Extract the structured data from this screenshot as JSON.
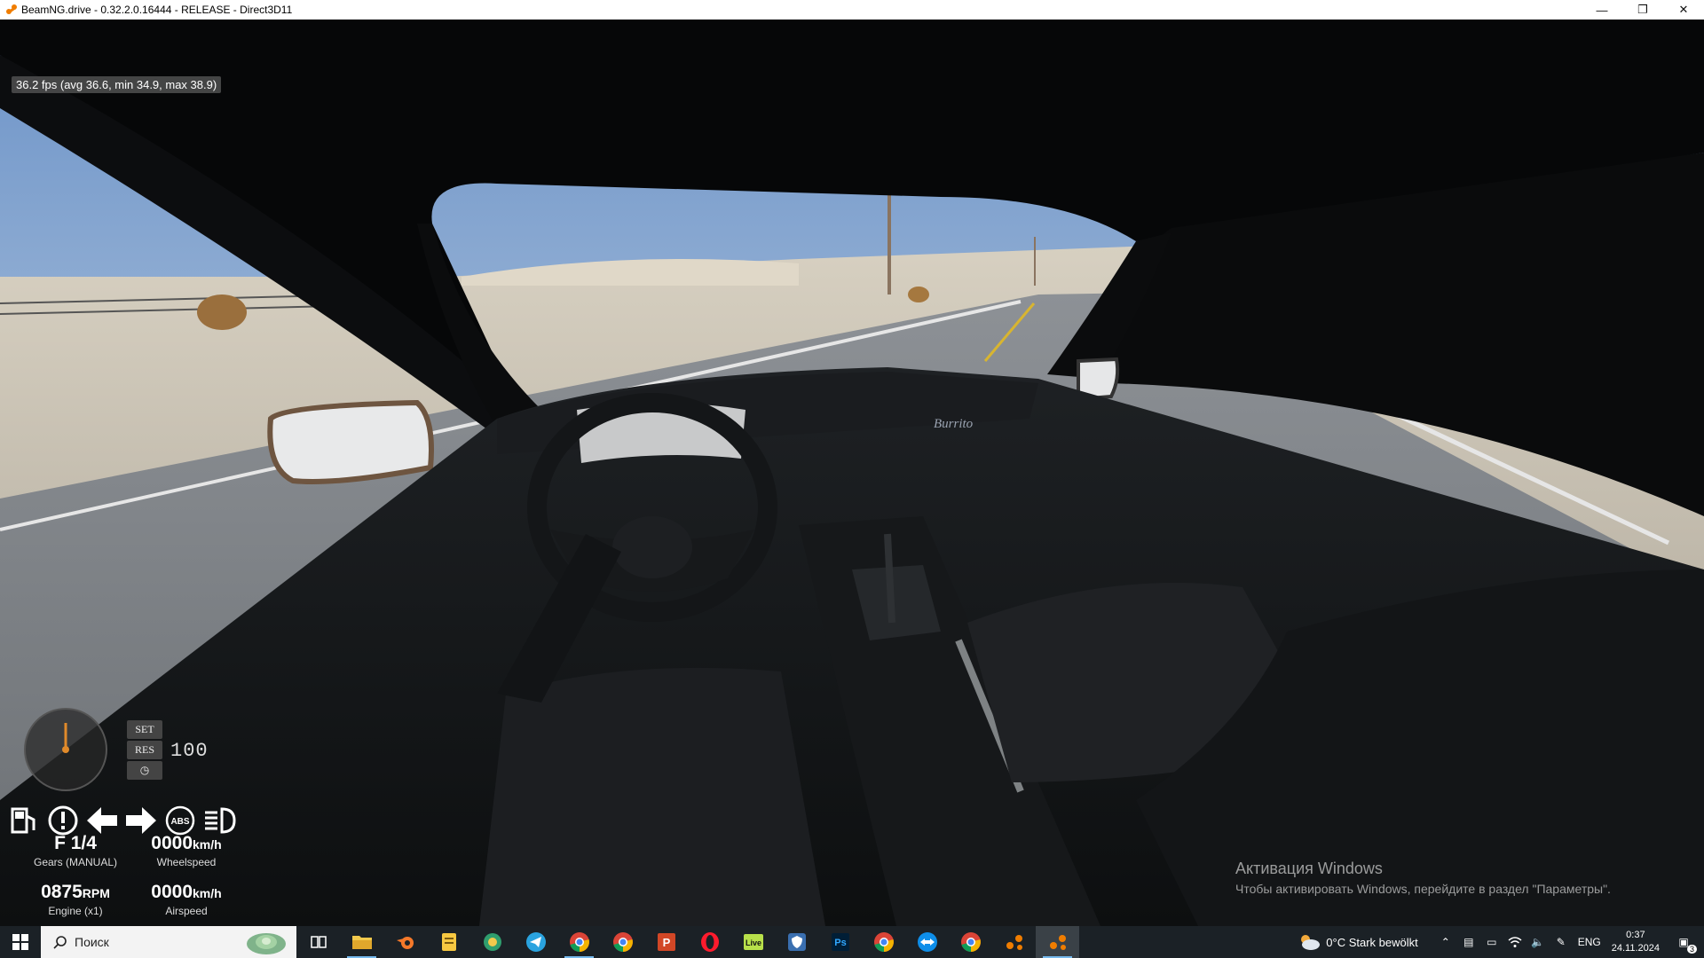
{
  "window": {
    "title": "BeamNG.drive - 0.32.2.0.16444 - RELEASE - Direct3D11",
    "minimize_icon": "minimize-icon",
    "restore_icon": "restore-icon",
    "close_icon": "close-icon"
  },
  "hud": {
    "fps": "36.2 fps (avg  36.6, min  34.9, max  38.9)",
    "cruise": {
      "set_label": "SET",
      "res_label": "RES",
      "speed_display": "100"
    },
    "indicators": [
      "fuel-icon",
      "warning-icon",
      "left-turn-arrow-icon",
      "right-turn-arrow-icon",
      "abs-icon",
      "headlight-icon"
    ],
    "gear": {
      "value": "F 1/4",
      "label": "Gears (MANUAL)"
    },
    "wheelspeed": {
      "value": "0000",
      "unit": "km/h",
      "label": "Wheelspeed"
    },
    "engine": {
      "value": "0875",
      "unit": "RPM",
      "label": "Engine (x1)"
    },
    "airspeed": {
      "value": "0000",
      "unit": "km/h",
      "label": "Airspeed"
    }
  },
  "activation": {
    "title": "Активация Windows",
    "subtitle": "Чтобы активировать Windows, перейдите в раздел \"Параметры\"."
  },
  "taskbar": {
    "search_placeholder": "Поиск",
    "apps": [
      "task-view-icon",
      "file-explorer-icon",
      "blender-icon",
      "notes-icon",
      "globe-icon",
      "telegram-icon",
      "chrome-icon",
      "chrome-icon",
      "powerpoint-icon",
      "opera-icon",
      "live-icon",
      "shield-app-icon",
      "photoshop-icon",
      "chrome-icon",
      "teamviewer-icon",
      "chrome-icon",
      "beamng-icon",
      "beamng-icon"
    ],
    "weather": "0°C  Stark bewölkt",
    "language": "ENG",
    "time": "0:37",
    "date": "24.11.2024",
    "notifications": "3"
  }
}
